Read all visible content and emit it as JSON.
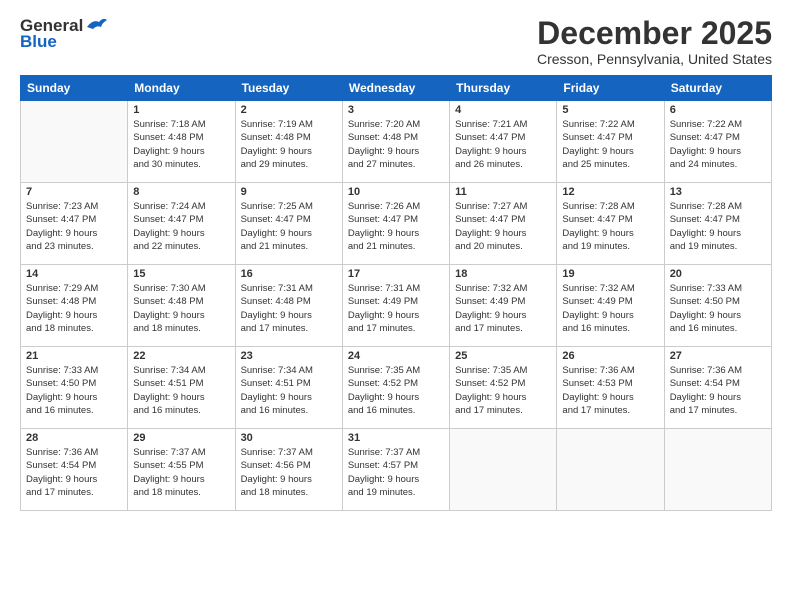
{
  "header": {
    "logo_general": "General",
    "logo_blue": "Blue",
    "month": "December 2025",
    "location": "Cresson, Pennsylvania, United States"
  },
  "days_of_week": [
    "Sunday",
    "Monday",
    "Tuesday",
    "Wednesday",
    "Thursday",
    "Friday",
    "Saturday"
  ],
  "weeks": [
    [
      {
        "day": "",
        "info": ""
      },
      {
        "day": "1",
        "info": "Sunrise: 7:18 AM\nSunset: 4:48 PM\nDaylight: 9 hours\nand 30 minutes."
      },
      {
        "day": "2",
        "info": "Sunrise: 7:19 AM\nSunset: 4:48 PM\nDaylight: 9 hours\nand 29 minutes."
      },
      {
        "day": "3",
        "info": "Sunrise: 7:20 AM\nSunset: 4:48 PM\nDaylight: 9 hours\nand 27 minutes."
      },
      {
        "day": "4",
        "info": "Sunrise: 7:21 AM\nSunset: 4:47 PM\nDaylight: 9 hours\nand 26 minutes."
      },
      {
        "day": "5",
        "info": "Sunrise: 7:22 AM\nSunset: 4:47 PM\nDaylight: 9 hours\nand 25 minutes."
      },
      {
        "day": "6",
        "info": "Sunrise: 7:22 AM\nSunset: 4:47 PM\nDaylight: 9 hours\nand 24 minutes."
      }
    ],
    [
      {
        "day": "7",
        "info": "Sunrise: 7:23 AM\nSunset: 4:47 PM\nDaylight: 9 hours\nand 23 minutes."
      },
      {
        "day": "8",
        "info": "Sunrise: 7:24 AM\nSunset: 4:47 PM\nDaylight: 9 hours\nand 22 minutes."
      },
      {
        "day": "9",
        "info": "Sunrise: 7:25 AM\nSunset: 4:47 PM\nDaylight: 9 hours\nand 21 minutes."
      },
      {
        "day": "10",
        "info": "Sunrise: 7:26 AM\nSunset: 4:47 PM\nDaylight: 9 hours\nand 21 minutes."
      },
      {
        "day": "11",
        "info": "Sunrise: 7:27 AM\nSunset: 4:47 PM\nDaylight: 9 hours\nand 20 minutes."
      },
      {
        "day": "12",
        "info": "Sunrise: 7:28 AM\nSunset: 4:47 PM\nDaylight: 9 hours\nand 19 minutes."
      },
      {
        "day": "13",
        "info": "Sunrise: 7:28 AM\nSunset: 4:47 PM\nDaylight: 9 hours\nand 19 minutes."
      }
    ],
    [
      {
        "day": "14",
        "info": "Sunrise: 7:29 AM\nSunset: 4:48 PM\nDaylight: 9 hours\nand 18 minutes."
      },
      {
        "day": "15",
        "info": "Sunrise: 7:30 AM\nSunset: 4:48 PM\nDaylight: 9 hours\nand 18 minutes."
      },
      {
        "day": "16",
        "info": "Sunrise: 7:31 AM\nSunset: 4:48 PM\nDaylight: 9 hours\nand 17 minutes."
      },
      {
        "day": "17",
        "info": "Sunrise: 7:31 AM\nSunset: 4:49 PM\nDaylight: 9 hours\nand 17 minutes."
      },
      {
        "day": "18",
        "info": "Sunrise: 7:32 AM\nSunset: 4:49 PM\nDaylight: 9 hours\nand 17 minutes."
      },
      {
        "day": "19",
        "info": "Sunrise: 7:32 AM\nSunset: 4:49 PM\nDaylight: 9 hours\nand 16 minutes."
      },
      {
        "day": "20",
        "info": "Sunrise: 7:33 AM\nSunset: 4:50 PM\nDaylight: 9 hours\nand 16 minutes."
      }
    ],
    [
      {
        "day": "21",
        "info": "Sunrise: 7:33 AM\nSunset: 4:50 PM\nDaylight: 9 hours\nand 16 minutes."
      },
      {
        "day": "22",
        "info": "Sunrise: 7:34 AM\nSunset: 4:51 PM\nDaylight: 9 hours\nand 16 minutes."
      },
      {
        "day": "23",
        "info": "Sunrise: 7:34 AM\nSunset: 4:51 PM\nDaylight: 9 hours\nand 16 minutes."
      },
      {
        "day": "24",
        "info": "Sunrise: 7:35 AM\nSunset: 4:52 PM\nDaylight: 9 hours\nand 16 minutes."
      },
      {
        "day": "25",
        "info": "Sunrise: 7:35 AM\nSunset: 4:52 PM\nDaylight: 9 hours\nand 17 minutes."
      },
      {
        "day": "26",
        "info": "Sunrise: 7:36 AM\nSunset: 4:53 PM\nDaylight: 9 hours\nand 17 minutes."
      },
      {
        "day": "27",
        "info": "Sunrise: 7:36 AM\nSunset: 4:54 PM\nDaylight: 9 hours\nand 17 minutes."
      }
    ],
    [
      {
        "day": "28",
        "info": "Sunrise: 7:36 AM\nSunset: 4:54 PM\nDaylight: 9 hours\nand 17 minutes."
      },
      {
        "day": "29",
        "info": "Sunrise: 7:37 AM\nSunset: 4:55 PM\nDaylight: 9 hours\nand 18 minutes."
      },
      {
        "day": "30",
        "info": "Sunrise: 7:37 AM\nSunset: 4:56 PM\nDaylight: 9 hours\nand 18 minutes."
      },
      {
        "day": "31",
        "info": "Sunrise: 7:37 AM\nSunset: 4:57 PM\nDaylight: 9 hours\nand 19 minutes."
      },
      {
        "day": "",
        "info": ""
      },
      {
        "day": "",
        "info": ""
      },
      {
        "day": "",
        "info": ""
      }
    ]
  ]
}
